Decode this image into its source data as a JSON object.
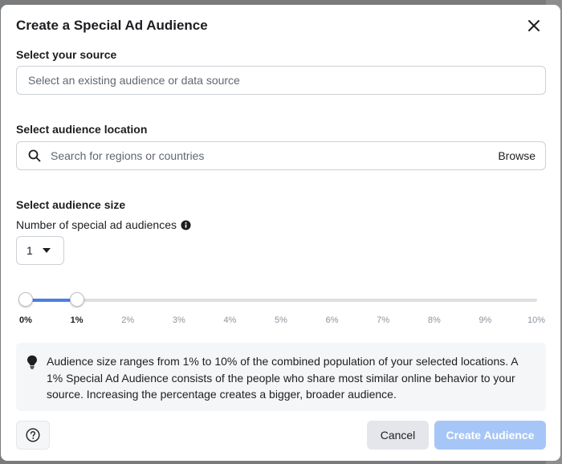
{
  "modal": {
    "title": "Create a Special Ad Audience",
    "close_icon": "close-icon"
  },
  "source": {
    "label": "Select your source",
    "placeholder": "Select an existing audience or data source",
    "value": ""
  },
  "location": {
    "label": "Select audience location",
    "placeholder": "Search for regions or countries",
    "value": "",
    "browse_label": "Browse",
    "icon": "search-icon"
  },
  "size": {
    "label": "Select audience size",
    "count_label": "Number of special ad audiences",
    "info_icon": "info-icon",
    "count_value": "1",
    "slider": {
      "min_percent": 0,
      "max_percent": 10,
      "range_start": 0,
      "range_end": 1,
      "ticks": [
        "0%",
        "1%",
        "2%",
        "3%",
        "4%",
        "5%",
        "6%",
        "7%",
        "8%",
        "9%",
        "10%"
      ],
      "active_ticks": [
        "0%",
        "1%"
      ],
      "fill_color": "#4a80e0"
    }
  },
  "info": {
    "icon": "lightbulb-icon",
    "text": "Audience size ranges from 1% to 10% of the combined population of your selected locations. A 1% Special Ad Audience consists of the people who share most similar online behavior to your source. Increasing the percentage creates a bigger, broader audience."
  },
  "footer": {
    "help_icon": "help-icon",
    "cancel_label": "Cancel",
    "create_label": "Create Audience",
    "create_color": "#a6c6f7"
  }
}
